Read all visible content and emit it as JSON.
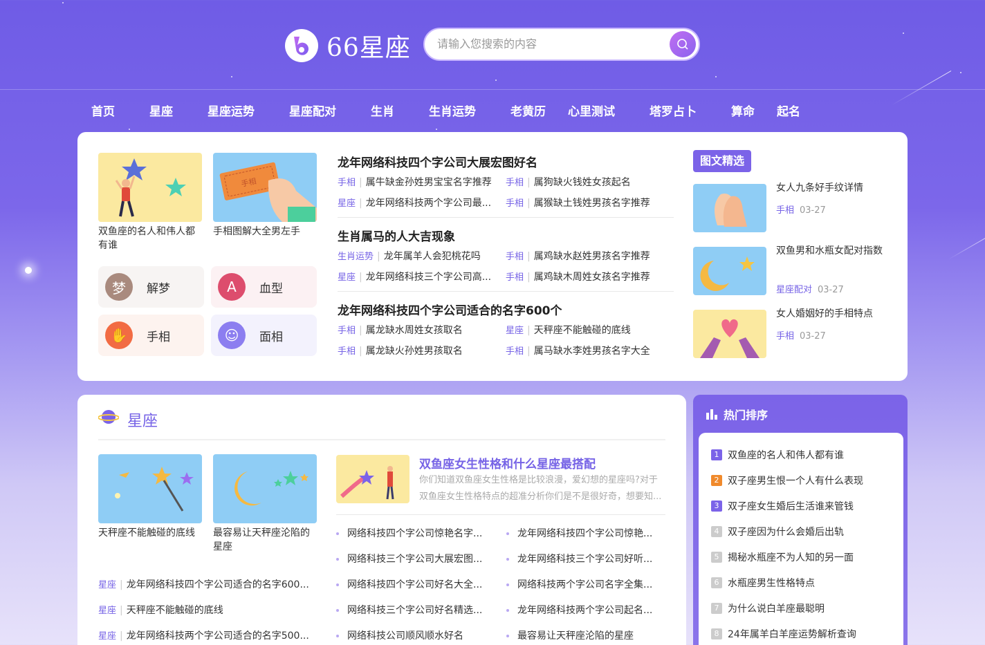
{
  "site": {
    "logo_text": "66星座",
    "search_placeholder": "请输入您搜索的内容"
  },
  "nav": [
    "首页",
    "星座",
    "星座运势",
    "星座配对",
    "生肖",
    "生肖运势",
    "老黄历",
    "心里测试",
    "塔罗占卜",
    "算命",
    "起名"
  ],
  "top": {
    "thumbs": [
      {
        "caption": "双鱼座的名人和伟人都有谁"
      },
      {
        "caption": "手相图解大全男左手",
        "ticket_text": "手相"
      }
    ],
    "tiles": [
      {
        "label": "解梦",
        "glyph": "梦",
        "color": "#a98a7e",
        "bg": "#f7f4f3"
      },
      {
        "label": "血型",
        "glyph": "A",
        "color": "#dd4d6d",
        "bg": "#fcf1f3"
      },
      {
        "label": "手相",
        "glyph": "✋",
        "color": "#f26b43",
        "bg": "#fdf3ef"
      },
      {
        "label": "面相",
        "glyph": "☺",
        "color": "#8c7ef0",
        "bg": "#f3f2fd"
      }
    ],
    "news": [
      {
        "title": "龙年网络科技四个字公司大展宏图好名",
        "rows": [
          [
            {
              "tag": "手相",
              "text": "属牛缺金孙姓男宝宝名字推荐"
            },
            {
              "tag": "手相",
              "text": "属狗缺火钱姓女孩起名"
            }
          ],
          [
            {
              "tag": "星座",
              "text": "龙年网络科技两个字公司最..."
            },
            {
              "tag": "手相",
              "text": "属猴缺土钱姓男孩名字推荐"
            }
          ]
        ]
      },
      {
        "title": "生肖属马的人大吉现象",
        "rows": [
          [
            {
              "tag": "生肖运势",
              "text": "龙年属羊人会犯桃花吗"
            },
            {
              "tag": "手相",
              "text": "属鸡缺水赵姓男孩名字推荐"
            }
          ],
          [
            {
              "tag": "星座",
              "text": "龙年网络科技三个字公司高..."
            },
            {
              "tag": "手相",
              "text": "属鸡缺木周姓女孩名字推荐"
            }
          ]
        ]
      },
      {
        "title": "龙年网络科技四个字公司适合的名字600个",
        "rows": [
          [
            {
              "tag": "手相",
              "text": "属龙缺水周姓女孩取名"
            },
            {
              "tag": "星座",
              "text": "天秤座不能触碰的底线"
            }
          ],
          [
            {
              "tag": "手相",
              "text": "属龙缺火孙姓男孩取名"
            },
            {
              "tag": "手相",
              "text": "属马缺水李姓男孩名字大全"
            }
          ]
        ]
      }
    ],
    "featured": {
      "badge": "图文精选",
      "items": [
        {
          "title": "女人九条好手纹详情",
          "tag": "手相",
          "date": "03-27"
        },
        {
          "title": "双鱼男和水瓶女配对指数",
          "tag": "星座配对",
          "date": "03-27"
        },
        {
          "title": "女人婚姻好的手相特点",
          "tag": "手相",
          "date": "03-27"
        }
      ]
    }
  },
  "zodiac": {
    "title": "星座",
    "thumbs": [
      {
        "caption": "天秤座不能触碰的底线"
      },
      {
        "caption": "最容易让天秤座沦陷的星座"
      }
    ],
    "tag_rows": [
      {
        "tag": "星座",
        "text": "龙年网络科技四个字公司适合的名字600..."
      },
      {
        "tag": "星座",
        "text": "天秤座不能触碰的底线"
      },
      {
        "tag": "星座",
        "text": "龙年网络科技两个字公司适合的名字500..."
      }
    ],
    "feature": {
      "title": "双鱼座女生性格和什么星座最搭配",
      "desc": "你们知道双鱼座女生性格是比较浪漫，爱幻想的星座吗?对于双鱼座女生性格特点的超准分析你们是不是很好奇，想要知..."
    },
    "list_left": [
      "网络科技四个字公司惊艳名字...",
      "网络科技三个字公司大展宏图...",
      "网络科技四个字公司好名大全...",
      "网络科技三个字公司好名精选...",
      "网络科技公司顺风顺水好名"
    ],
    "list_right": [
      "龙年网络科技四个字公司惊艳...",
      "龙年网络科技三个字公司好听...",
      "网络科技两个字公司名字全集...",
      "龙年网络科技两个字公司起名...",
      "最容易让天秤座沦陷的星座"
    ]
  },
  "ranking": {
    "title": "热门排序",
    "items": [
      {
        "num": "1",
        "text": "双鱼座的名人和伟人都有谁",
        "color": "#7b63e8"
      },
      {
        "num": "2",
        "text": "双子座男生恨一个人有什么表现",
        "color": "#f08a2c"
      },
      {
        "num": "3",
        "text": "双子座女生婚后生活谁来管钱",
        "color": "#7b63e8"
      },
      {
        "num": "4",
        "text": "双子座因为什么会婚后出轨",
        "color": "#cccccc"
      },
      {
        "num": "5",
        "text": "揭秘水瓶座不为人知的另一面",
        "color": "#cccccc"
      },
      {
        "num": "6",
        "text": "水瓶座男生性格特点",
        "color": "#cccccc"
      },
      {
        "num": "7",
        "text": "为什么说白羊座最聪明",
        "color": "#cccccc"
      },
      {
        "num": "8",
        "text": "24年属羊白羊座运势解析查询",
        "color": "#cccccc"
      }
    ]
  }
}
